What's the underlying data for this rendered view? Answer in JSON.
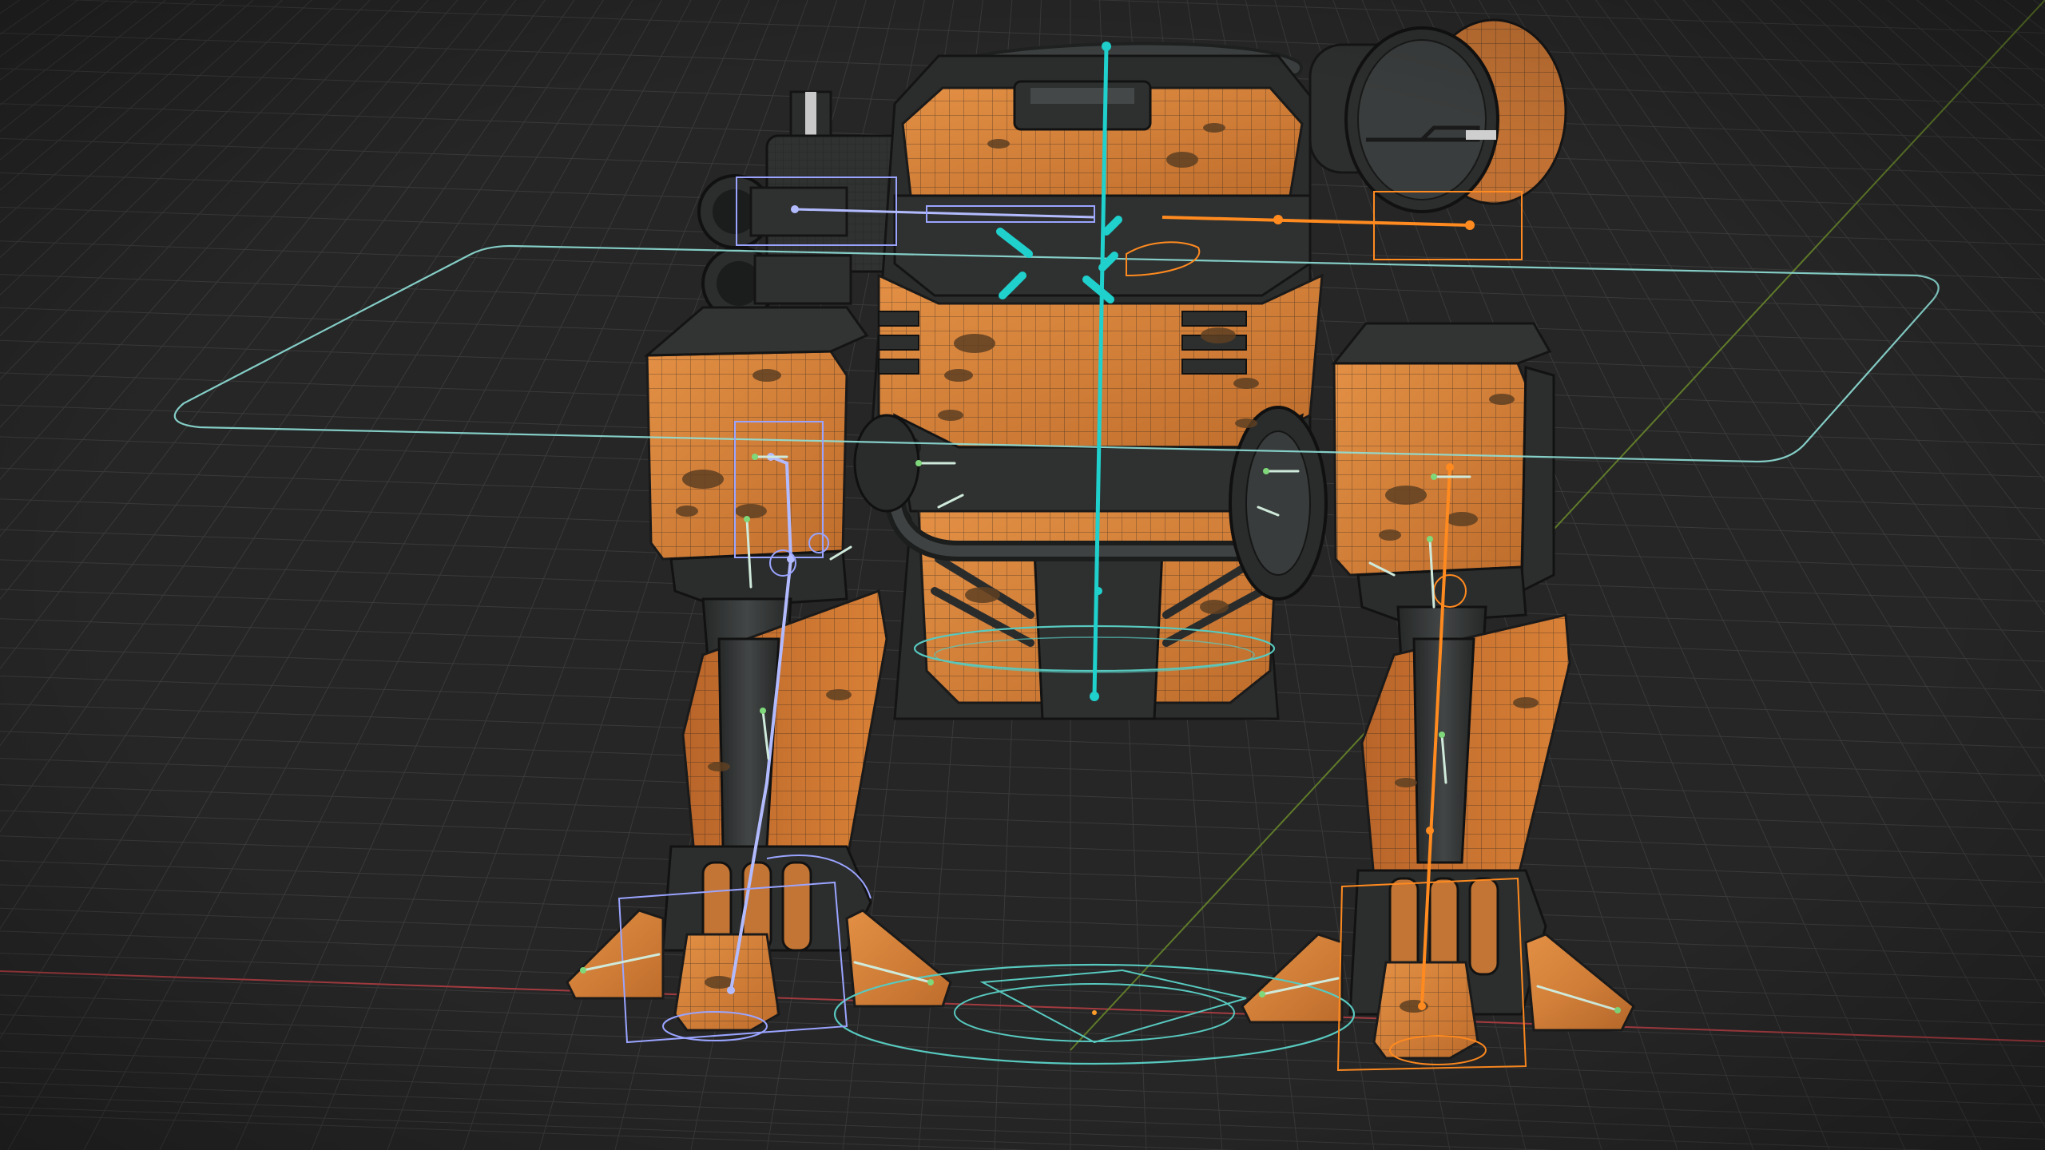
{
  "app": {
    "name": "3D viewport",
    "view": "perspective"
  },
  "viewport": {
    "background": "#262626",
    "grid_color": "#3a3a3a",
    "axis_x_color": "#b0363c",
    "axis_y_color": "#6a8a2a",
    "overlays": {
      "grid": true,
      "wireframe": true,
      "bones": true
    }
  },
  "scene": {
    "object": "mech",
    "armature": "mech-rig",
    "material_colors": {
      "body_orange": "#d7823a",
      "body_orange_dark": "#a45a22",
      "rust_spots": "#5e3f22",
      "metal_dark": "#2f3131",
      "metal_mid": "#3f4242",
      "wire_lines": "#1b1b1b"
    },
    "control_colors": {
      "root_control": "#58c9bf",
      "spine_bone": "#1fd0cc",
      "left_chain": "#9aa4ff",
      "right_chain": "#ff8a1f",
      "small_bones": "#cfeadb",
      "bone_joints": "#7fd87a"
    },
    "controls": [
      {
        "name": "root-circle-control",
        "type": "circle",
        "color_key": "root_control"
      },
      {
        "name": "torso-plane-control",
        "type": "rounded-rect",
        "color_key": "root_control"
      },
      {
        "name": "spine-bone",
        "type": "bone",
        "color_key": "spine_bone"
      },
      {
        "name": "left-leg-ik-chain",
        "type": "ik-chain",
        "color_key": "left_chain"
      },
      {
        "name": "right-leg-ik-chain",
        "type": "ik-chain",
        "color_key": "right_chain"
      },
      {
        "name": "gun-control",
        "type": "bone",
        "color_key": "left_chain"
      },
      {
        "name": "cannon-control",
        "type": "bone",
        "color_key": "right_chain"
      }
    ]
  }
}
